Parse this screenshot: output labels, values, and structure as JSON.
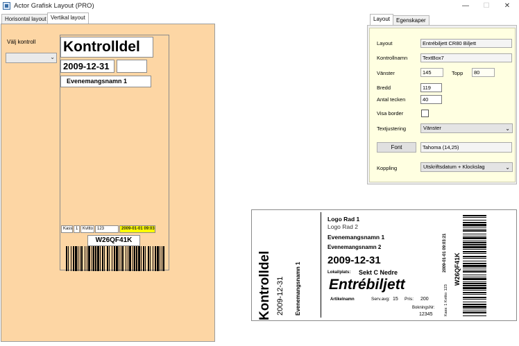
{
  "window": {
    "title": "Actor Grafisk Layout  (PRO)",
    "min_glyph": "—",
    "max_glyph": "☐",
    "close_glyph": "✕"
  },
  "left_tabs": [
    {
      "label": "Horisontal layout"
    },
    {
      "label": "Vertikal layout"
    }
  ],
  "designer": {
    "valj_label": "Välj kontroll",
    "valj_value": "",
    "kontrolldel": "Kontrolldel",
    "date": "2009-12-31",
    "event_name": "Evenemangsnamn 1",
    "small_fields": [
      "Kass",
      "1",
      "Kvitto",
      "123",
      "2009-01-01 09:03:21"
    ],
    "code": "W26QF41K",
    "highlight_color": "#ffff00"
  },
  "right_tabs": [
    {
      "label": "Layout"
    },
    {
      "label": "Egenskaper"
    }
  ],
  "properties": {
    "layout_label": "Layout",
    "layout_value": "Entrébiljett CR80 Biljett",
    "name_label": "Kontrollnamn",
    "name_value": "TextBox7",
    "left_label": "Vänster",
    "left_value": "145",
    "top_label": "Topp",
    "top_value": "80",
    "width_label": "Bredd",
    "width_value": "119",
    "chars_label": "Antal tecken",
    "chars_value": "40",
    "border_label": "Visa border",
    "align_label": "Textjustering",
    "align_value": "Vänster",
    "font_button": "Font",
    "font_value": "Tahoma (14,25)",
    "link_label": "Koppling",
    "link_value": "Utskriftsdatum + Klockslag"
  },
  "preview": {
    "logo1": "Logo Rad 1",
    "logo2": "Logo Rad 2",
    "event1": "Evenemangsnamn 1",
    "event2": "Evenemangsnamn 2",
    "date": "2009-12-31",
    "venue_label": "Lokal/plats:",
    "venue_value": "Sekt C Nedre",
    "entrebiljett": "Entrébiljett",
    "article_label": "Artikelnamn",
    "service_label": "Serv.avg:",
    "service_value": "15",
    "price_label": "Pris:",
    "price_value": "200",
    "booking_label": "BokningsNr:",
    "booking_value": "12345",
    "side_kontrolldel": "Kontrolldel",
    "side_date": "2009-12-31",
    "side_event": "Evenemangsnamn 1",
    "side_datetime": "2009-01-01 09:03:21",
    "side_kass": "Kass: 1  Kvitto: 123",
    "side_code": "W26QF41K"
  }
}
